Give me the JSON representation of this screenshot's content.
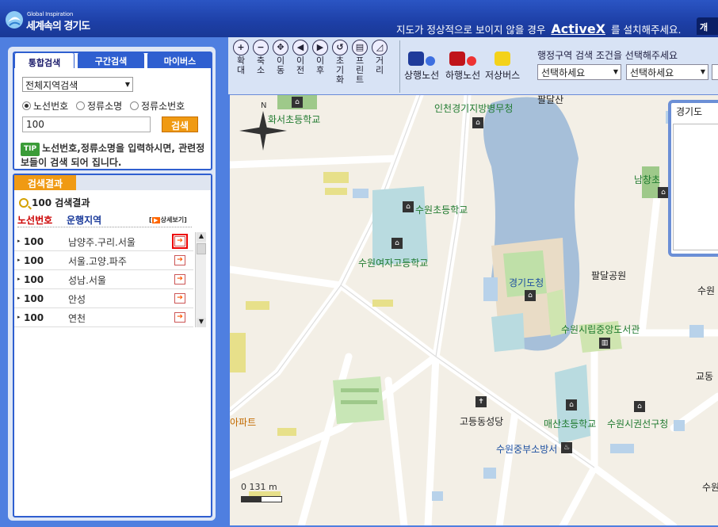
{
  "header": {
    "logo_small": "Global Inspiration",
    "logo_big": "세계속의 경기도",
    "activex_prefix": "지도가 정상적으로 보이지 않을 경우",
    "activex_link": "ActiveX",
    "activex_suffix": "를 설치해주세요.",
    "cut_button": "개"
  },
  "sidebar": {
    "tabs": [
      "통합검색",
      "구간검색",
      "마이버스"
    ],
    "region_select": "전체지역검색",
    "radios": [
      "노선번호",
      "정류소명",
      "정류소번호"
    ],
    "radio_selected": 0,
    "search_value": "100",
    "search_button": "검색",
    "tip_badge": "TIP",
    "tip_text": "노선번호,정류소명을 입력하시면, 관련정보들이 검색 되어 집니다."
  },
  "results": {
    "tab": "검색결과",
    "title": "100 검색결과",
    "col_route": "노선번호",
    "col_area": "운행지역",
    "detail_label": "상세보기",
    "rows": [
      {
        "no": "100",
        "area": "남양주.구리.서울"
      },
      {
        "no": "100",
        "area": "서울.고양.파주"
      },
      {
        "no": "100",
        "area": "성남.서울"
      },
      {
        "no": "100",
        "area": "안성"
      },
      {
        "no": "100",
        "area": "연천"
      }
    ]
  },
  "toolbar": {
    "tools": [
      {
        "icon": "zoom-in-icon",
        "glyph": "+",
        "label": "확대"
      },
      {
        "icon": "zoom-out-icon",
        "glyph": "−",
        "label": "축소"
      },
      {
        "icon": "move-icon",
        "glyph": "✥",
        "label": "이동"
      },
      {
        "icon": "prev-icon",
        "glyph": "◀",
        "label": "이전"
      },
      {
        "icon": "next-icon",
        "glyph": "▶",
        "label": "이후"
      },
      {
        "icon": "reset-icon",
        "glyph": "↺",
        "label": "초기화"
      },
      {
        "icon": "print-icon",
        "glyph": "▤",
        "label": "프린트"
      },
      {
        "icon": "distance-icon",
        "glyph": "◿",
        "label": "거리"
      }
    ],
    "bus_buttons": [
      "상행노선",
      "하행노선",
      "저상버스"
    ],
    "region_label": "행정구역 검색 조건을 선택해주세요",
    "select1": "선택하세요",
    "select2": "선택하세요"
  },
  "map": {
    "overview_title": "경기도",
    "scale_label": "0  131 m",
    "labels": [
      {
        "text": "화서초등학교",
        "cls": "green"
      },
      {
        "text": "인천경기지방병무청",
        "cls": "green"
      },
      {
        "text": "팔달산",
        "cls": "dark"
      },
      {
        "text": "남창초",
        "cls": "green"
      },
      {
        "text": "수원초등학교",
        "cls": "green"
      },
      {
        "text": "수원여자고등학교",
        "cls": "green"
      },
      {
        "text": "경기도청",
        "cls": "blue"
      },
      {
        "text": "팔달공원",
        "cls": "dark"
      },
      {
        "text": "수원",
        "cls": "dark"
      },
      {
        "text": "수원시립중앙도서관",
        "cls": "green"
      },
      {
        "text": "교동",
        "cls": "dark"
      },
      {
        "text": "아파트",
        "cls": "orange"
      },
      {
        "text": "고등동성당",
        "cls": "dark"
      },
      {
        "text": "매산초등학교",
        "cls": "green"
      },
      {
        "text": "수원시권선구청",
        "cls": "green"
      },
      {
        "text": "수원중부소방서",
        "cls": "blue"
      },
      {
        "text": "수원",
        "cls": "dark"
      }
    ]
  }
}
